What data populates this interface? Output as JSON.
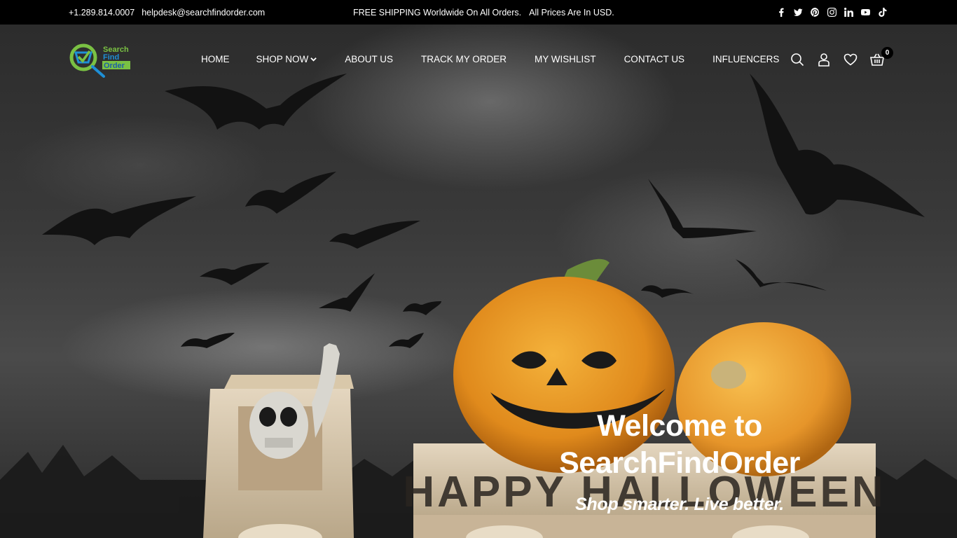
{
  "topbar": {
    "phone": "+1.289.814.0007",
    "email": "helpdesk@searchfindorder.com",
    "shipping": "FREE SHIPPING Worldwide On All Orders.",
    "currency": "All Prices Are In USD.",
    "social_icons": [
      "facebook-icon",
      "twitter-icon",
      "pinterest-icon",
      "instagram-icon",
      "linkedin-icon",
      "youtube-icon",
      "tiktok-icon"
    ]
  },
  "logo": {
    "line1": "Search",
    "line2": "Find",
    "line3": "Order",
    "colors": {
      "green": "#7ac143",
      "blue": "#1e8fd6"
    }
  },
  "nav": {
    "home": "HOME",
    "shop_now": "SHOP NOW",
    "about": "ABOUT US",
    "track": "TRACK MY ORDER",
    "wishlist": "MY WISHLIST",
    "contact": "CONTACT US",
    "influencers": "INFLUENCERS"
  },
  "header_icons": {
    "cart_count": "0"
  },
  "hero": {
    "headline_line1": "Welcome to",
    "headline_line2": "SearchFindOrder",
    "tagline": "Shop smarter. Live better.",
    "sign_text": "HAPPY HALLOWEEN"
  }
}
